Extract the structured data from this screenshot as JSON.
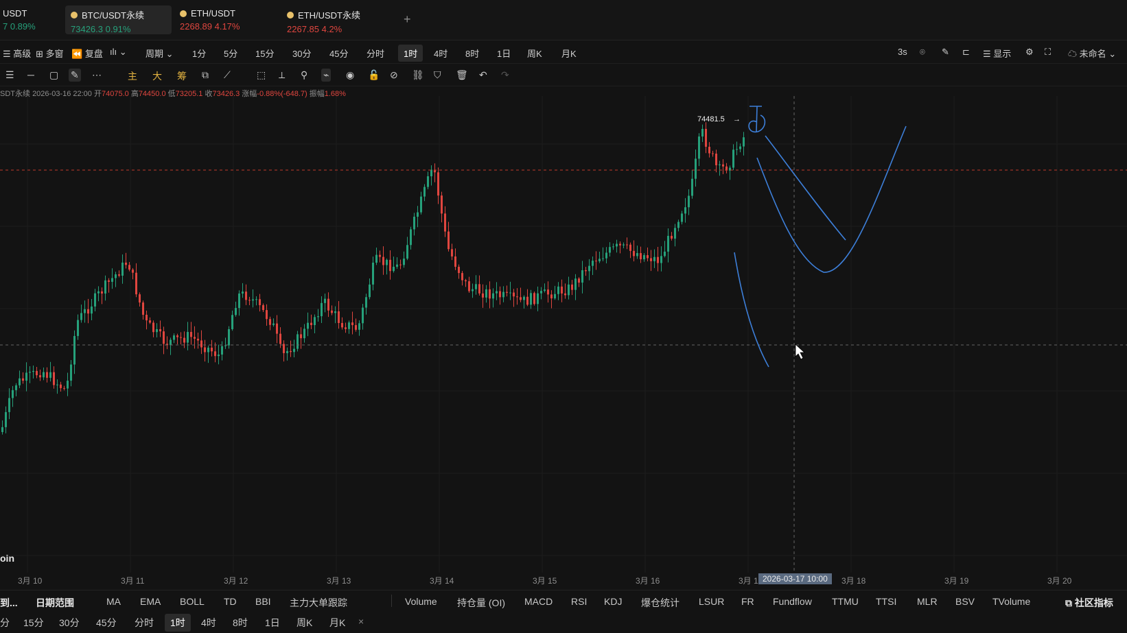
{
  "tabs": [
    {
      "name": "USDT",
      "quote": "7 0.89%",
      "color": "#26a17b"
    },
    {
      "name": "BTC/USDT永续",
      "quote": "73426.3 0.91%",
      "color": "#26a17b"
    },
    {
      "name": "ETH/USDT",
      "quote": "2268.89 4.17%",
      "color": "#e0463f"
    },
    {
      "name": "ETH/USDT永续",
      "quote": "2267.85 4.2%",
      "color": "#e0463f"
    }
  ],
  "new_tab": "+",
  "toolbar": {
    "advanced": "高级",
    "multi": "多窗",
    "replay": "复盘",
    "period_label": "周期",
    "periods": [
      "1分",
      "5分",
      "15分",
      "30分",
      "45分",
      "分时",
      "1时",
      "4时",
      "8时",
      "1日",
      "周K",
      "月K"
    ],
    "active_period": "1时",
    "refresh": "3s",
    "display": "显示",
    "layout_name": "未命名"
  },
  "drawing_tools": {
    "main": "主",
    "big": "大",
    "chips": "筹"
  },
  "ohlc": {
    "symbol": "SDT永续",
    "datetime": "2026-03-16 22:00",
    "open_label": "开",
    "open": "74075.0",
    "high_label": "高",
    "high": "74450.0",
    "low_label": "低",
    "low": "73205.1",
    "close_label": "收",
    "close": "73426.3",
    "change_label": "涨幅",
    "change": "-0.88%(-648.7)",
    "amp_label": "振幅",
    "amp": "1.68%"
  },
  "peak_label": "74481.5",
  "coin_label": "oin",
  "x_axis": {
    "labels": [
      "3月 10",
      "3月 11",
      "3月 12",
      "3月 13",
      "3月 14",
      "3月 15",
      "3月 16",
      "3月 1",
      "3月 18",
      "3月 19",
      "3月 20"
    ],
    "crosshair": "2026-03-17 10:00"
  },
  "indicators": {
    "left": [
      "到...",
      "日期范围"
    ],
    "main": [
      "MA",
      "EMA",
      "BOLL",
      "TD",
      "BBI",
      "主力大单跟踪"
    ],
    "sub": [
      "Volume",
      "持仓量 (OI)",
      "MACD",
      "RSI",
      "KDJ",
      "爆仓统计",
      "LSUR",
      "FR",
      "Fundflow",
      "TTMU",
      "TTSI",
      "MLR",
      "BSV",
      "TVolume"
    ],
    "community": "社区指标"
  },
  "bottom_periods": [
    "分",
    "15分",
    "30分",
    "45分",
    "分时",
    "1时",
    "4时",
    "8时",
    "1日",
    "周K",
    "月K"
  ],
  "bottom_active": "1时",
  "close_x": "×",
  "colors": {
    "up": "#26a17b",
    "down": "#e0463f",
    "drawing": "#3d7fd9",
    "bg": "#131313"
  }
}
